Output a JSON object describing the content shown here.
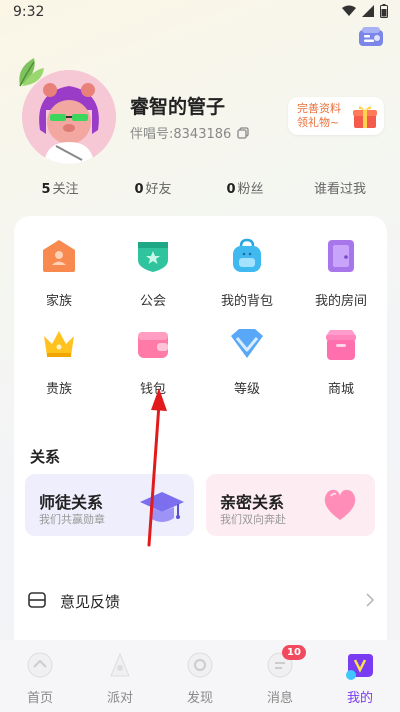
{
  "status": {
    "time": "9:32"
  },
  "profile": {
    "name": "睿智的管子",
    "id_text": "伴唱号:8343186"
  },
  "promo": {
    "line1": "完善资料",
    "line2": "领礼物~"
  },
  "stats": [
    {
      "count": "5",
      "label": "关注"
    },
    {
      "count": "0",
      "label": "好友"
    },
    {
      "count": "0",
      "label": "粉丝"
    },
    {
      "count": "",
      "label": "谁看过我"
    }
  ],
  "menu": [
    {
      "label": "家族"
    },
    {
      "label": "公会"
    },
    {
      "label": "我的背包"
    },
    {
      "label": "我的房间"
    },
    {
      "label": "贵族"
    },
    {
      "label": "钱包"
    },
    {
      "label": "等级"
    },
    {
      "label": "商城"
    }
  ],
  "relations": {
    "title": "关系",
    "mentor": {
      "title": "师徒关系",
      "subtitle": "我们共赢勋章"
    },
    "intimate": {
      "title": "亲密关系",
      "subtitle": "我们双向奔赴"
    }
  },
  "feedback": {
    "label": "意见反馈"
  },
  "tabs": [
    {
      "label": "首页"
    },
    {
      "label": "派对"
    },
    {
      "label": "发现"
    },
    {
      "label": "消息",
      "badge": "10"
    },
    {
      "label": "我的"
    }
  ],
  "colors": {
    "accent": "#7a3cf2",
    "badge": "#f14a5e",
    "promo": "#e8703a"
  }
}
